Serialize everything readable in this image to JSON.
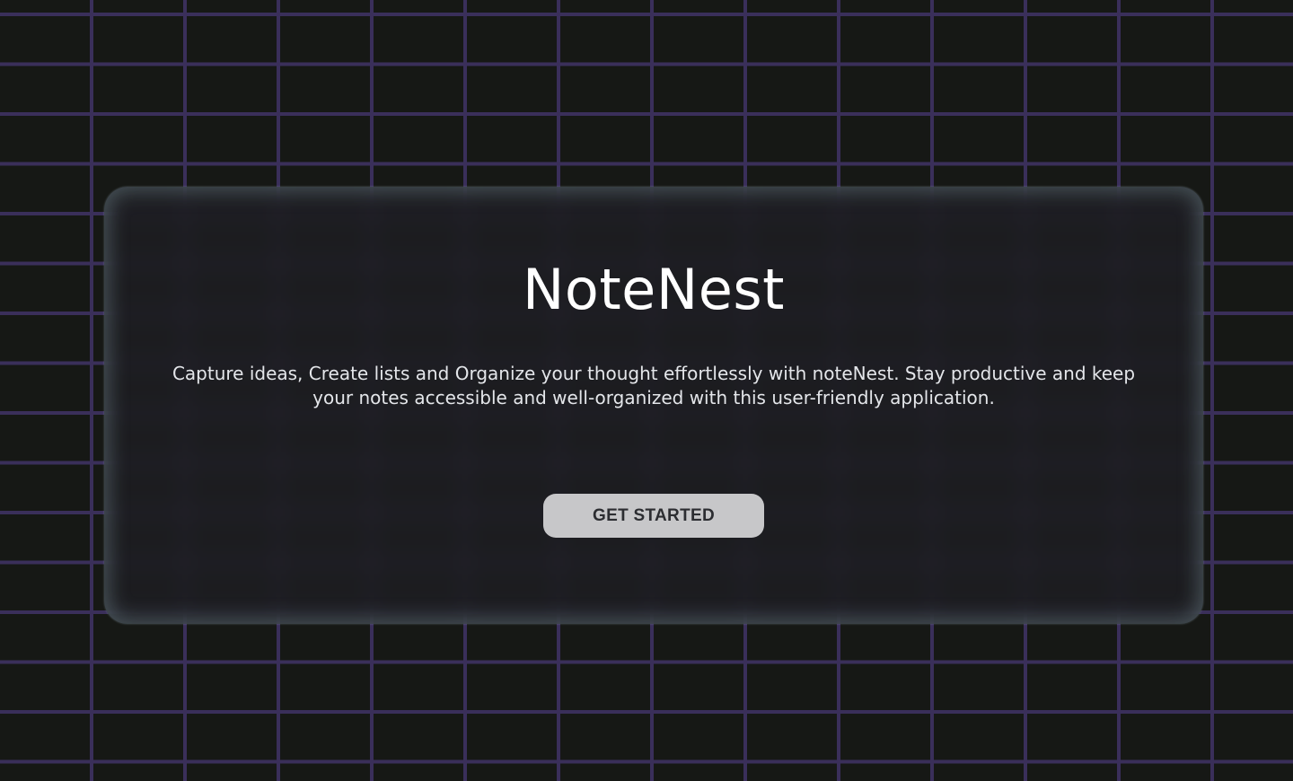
{
  "hero": {
    "title": "NoteNest",
    "description": "Capture ideas, Create lists and Organize your thought effortlessly with noteNest. Stay productive and keep your notes accessible and well-organized with this user-friendly application.",
    "cta_label": "GET STARTED"
  },
  "colors": {
    "background": "#161815",
    "grid_lines": "#3a2f5a",
    "card_glow": "#8ca5af",
    "title_text": "#ffffff",
    "button_bg": "#c7c7c9",
    "button_text": "#2c2d31"
  }
}
